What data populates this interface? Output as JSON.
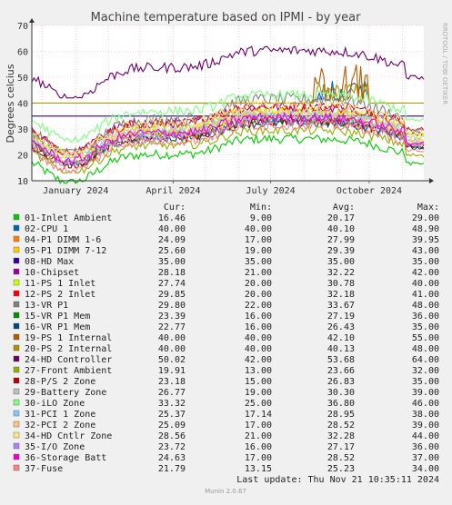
{
  "chart_data": {
    "type": "line",
    "title": "Machine temperature based on IPMI - by year",
    "ylabel": "Degrees celcius",
    "ylim": [
      10,
      70
    ],
    "yticks": [
      10,
      20,
      30,
      40,
      50,
      60,
      70
    ],
    "xticks": [
      "January 2024",
      "April 2024",
      "July 2024",
      "October 2024"
    ],
    "xrange": [
      "2023-11-21",
      "2024-11-21"
    ],
    "grid": true,
    "side_label": "RRDTOOL / TOBI OETIKER",
    "legend_headers": [
      "Cur:",
      "Min:",
      "Avg:",
      "Max:"
    ],
    "series": [
      {
        "name": "01-Inlet Ambient",
        "color": "#00cc00",
        "cur": "16.46",
        "min": "9.00",
        "avg": "20.17",
        "max": "29.00"
      },
      {
        "name": "02-CPU 1",
        "color": "#0066b3",
        "cur": "40.00",
        "min": "40.00",
        "avg": "40.10",
        "max": "48.90"
      },
      {
        "name": "04-P1 DIMM 1-6",
        "color": "#ff8000",
        "cur": "24.09",
        "min": "17.00",
        "avg": "27.99",
        "max": "39.95"
      },
      {
        "name": "05-P1 DIMM 7-12",
        "color": "#ffcc00",
        "cur": "25.60",
        "min": "19.00",
        "avg": "29.39",
        "max": "43.00"
      },
      {
        "name": "08-HD Max",
        "color": "#330099",
        "cur": "35.00",
        "min": "35.00",
        "avg": "35.00",
        "max": "35.00"
      },
      {
        "name": "10-Chipset",
        "color": "#990099",
        "cur": "28.18",
        "min": "21.00",
        "avg": "32.22",
        "max": "42.00"
      },
      {
        "name": "11-PS 1 Inlet",
        "color": "#ccff00",
        "cur": "27.74",
        "min": "20.00",
        "avg": "30.78",
        "max": "40.00"
      },
      {
        "name": "12-PS 2 Inlet",
        "color": "#ff0000",
        "cur": "29.85",
        "min": "20.00",
        "avg": "32.18",
        "max": "41.00"
      },
      {
        "name": "13-VR P1",
        "color": "#808080",
        "cur": "29.80",
        "min": "22.00",
        "avg": "33.67",
        "max": "48.00"
      },
      {
        "name": "15-VR P1 Mem",
        "color": "#008f00",
        "cur": "23.39",
        "min": "16.00",
        "avg": "27.19",
        "max": "36.00"
      },
      {
        "name": "16-VR P1 Mem",
        "color": "#00487d",
        "cur": "22.77",
        "min": "16.00",
        "avg": "26.43",
        "max": "35.00"
      },
      {
        "name": "19-PS 1 Internal",
        "color": "#b35a00",
        "cur": "40.00",
        "min": "40.00",
        "avg": "42.10",
        "max": "55.00"
      },
      {
        "name": "20-PS 2 Internal",
        "color": "#b38f00",
        "cur": "40.00",
        "min": "40.00",
        "avg": "40.13",
        "max": "48.00"
      },
      {
        "name": "24-HD Controller",
        "color": "#6b006b",
        "cur": "50.02",
        "min": "42.00",
        "avg": "53.68",
        "max": "64.00"
      },
      {
        "name": "27-Front Ambient",
        "color": "#8fb300",
        "cur": "19.91",
        "min": "13.00",
        "avg": "23.66",
        "max": "32.00"
      },
      {
        "name": "28-P/S 2 Zone",
        "color": "#b30000",
        "cur": "23.18",
        "min": "15.00",
        "avg": "26.83",
        "max": "35.00"
      },
      {
        "name": "29-Battery Zone",
        "color": "#bebebe",
        "cur": "26.77",
        "min": "19.00",
        "avg": "30.30",
        "max": "39.00"
      },
      {
        "name": "30-iLO Zone",
        "color": "#80ff80",
        "cur": "33.32",
        "min": "25.00",
        "avg": "36.80",
        "max": "46.00"
      },
      {
        "name": "31-PCI 1 Zone",
        "color": "#80c9ff",
        "cur": "25.37",
        "min": "17.14",
        "avg": "28.95",
        "max": "38.00"
      },
      {
        "name": "32-PCI 2 Zone",
        "color": "#ffc080",
        "cur": "25.09",
        "min": "17.00",
        "avg": "28.52",
        "max": "39.00"
      },
      {
        "name": "34-HD Cntlr Zone",
        "color": "#ffe680",
        "cur": "28.56",
        "min": "21.00",
        "avg": "32.28",
        "max": "44.00"
      },
      {
        "name": "35-I/O Zone",
        "color": "#aa80ff",
        "cur": "23.72",
        "min": "16.00",
        "avg": "27.17",
        "max": "36.00"
      },
      {
        "name": "36-Storage Batt",
        "color": "#ee00cc",
        "cur": "24.63",
        "min": "17.00",
        "avg": "28.52",
        "max": "37.00"
      },
      {
        "name": "37-Fuse",
        "color": "#ff8080",
        "cur": "21.79",
        "min": "13.15",
        "avg": "25.23",
        "max": "34.00"
      }
    ]
  },
  "footer": {
    "last_update": "Last update: Thu Nov 21 10:35:11 2024",
    "version": "Munin 2.0.67"
  }
}
